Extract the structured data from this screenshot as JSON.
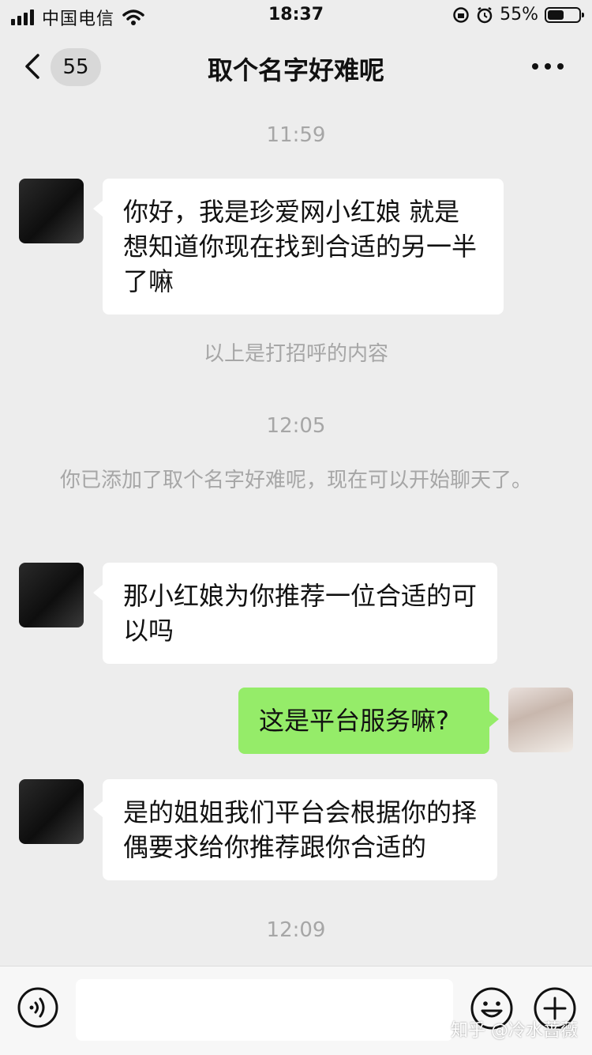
{
  "status_bar": {
    "carrier": "中国电信",
    "time": "18:37",
    "battery": "55%",
    "battery_level": 0.55
  },
  "nav": {
    "unread_count": "55",
    "title": "取个名字好难呢"
  },
  "messages": [
    {
      "type": "time",
      "text": "11:59"
    },
    {
      "type": "in",
      "text": "你好，我是珍爱网小红娘 就是想知道你现在找到合适的另一半了嘛"
    },
    {
      "type": "system",
      "text": "以上是打招呼的内容"
    },
    {
      "type": "time",
      "text": "12:05"
    },
    {
      "type": "system",
      "text": "你已添加了取个名字好难呢，现在可以开始聊天了。"
    },
    {
      "type": "in",
      "text": "那小红娘为你推荐一位合适的可以吗"
    },
    {
      "type": "out",
      "text": "这是平台服务嘛?"
    },
    {
      "type": "in",
      "text": "是的姐姐我们平台会根据你的择偶要求给你推荐跟你合适的"
    },
    {
      "type": "time",
      "text": "12:09"
    }
  ],
  "input_bar": {
    "value": "",
    "icons": [
      "voice-icon",
      "emoji-icon",
      "plus-icon"
    ]
  },
  "watermark": "知乎 @冷水蔷薇",
  "colors": {
    "background": "#ededed",
    "incoming_bubble": "#ffffff",
    "outgoing_bubble": "#95ec69",
    "muted_text": "#a6a6a6"
  }
}
